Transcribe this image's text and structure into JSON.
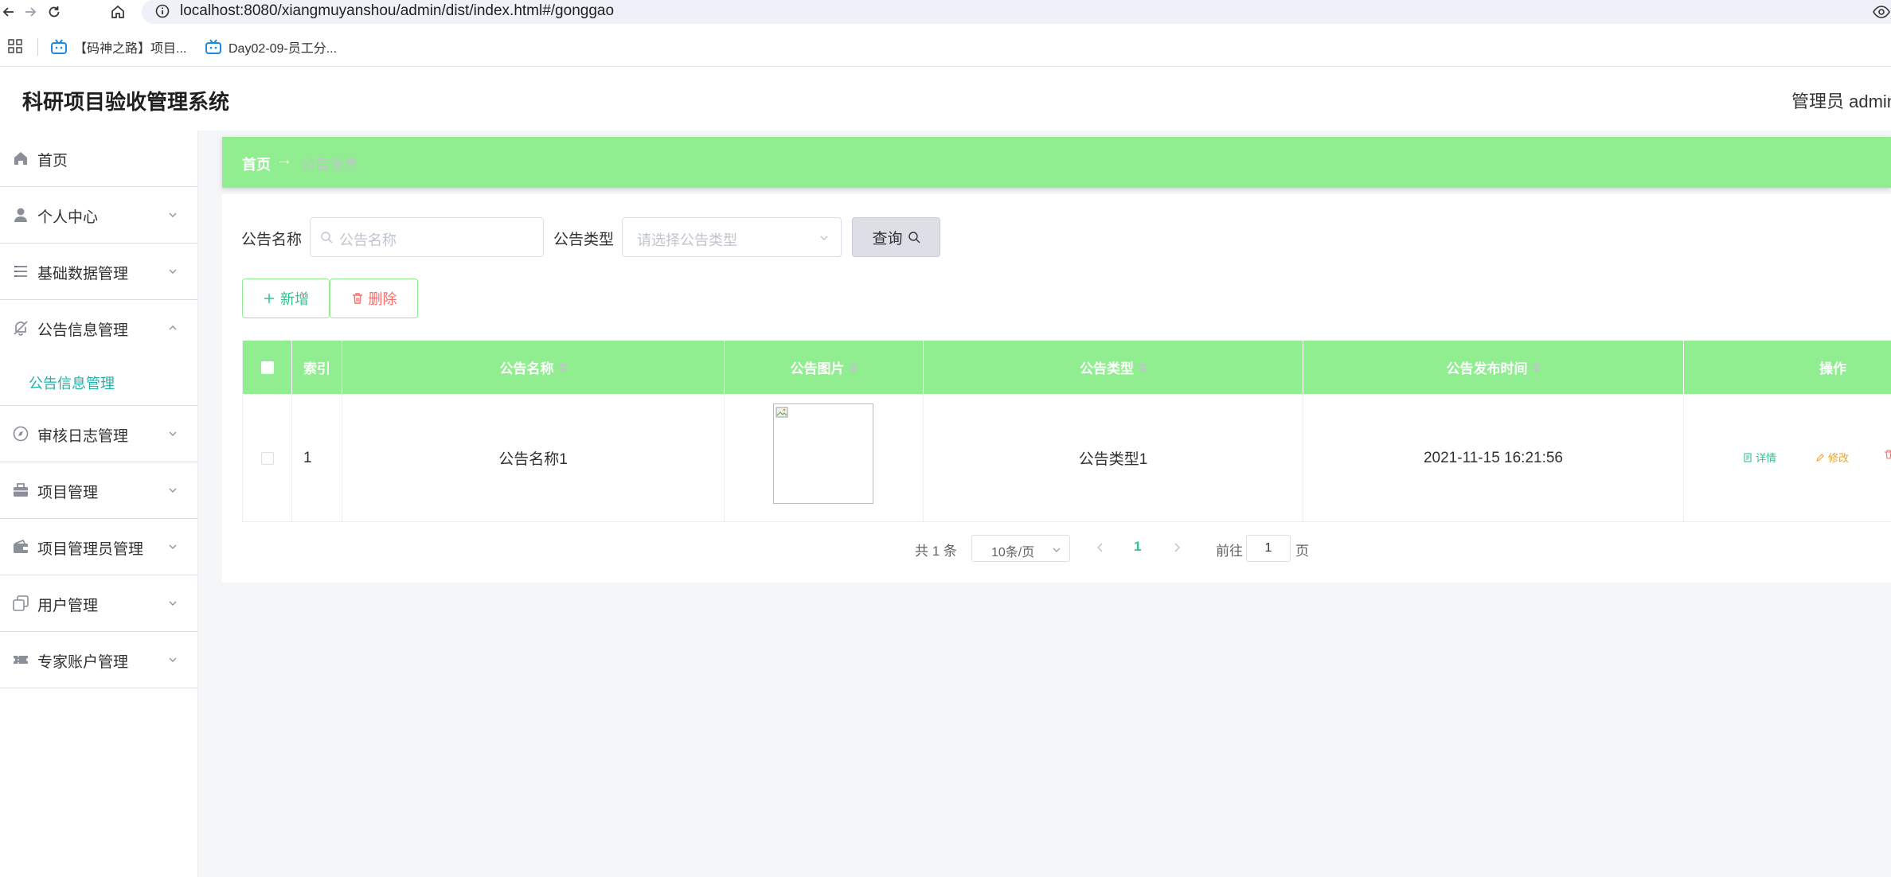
{
  "browser": {
    "url": "localhost:8080/xiangmuyanshou/admin/dist/index.html#/gonggao",
    "bookmarks": [
      {
        "label": "【码神之路】项目..."
      },
      {
        "label": "Day02-09-员工分..."
      }
    ]
  },
  "app": {
    "title": "科研项目验收管理系统",
    "user": "管理员 admin"
  },
  "sidebar": {
    "items": [
      {
        "label": "首页",
        "icon": "home-icon"
      },
      {
        "label": "个人中心",
        "icon": "user-icon"
      },
      {
        "label": "基础数据管理",
        "icon": "list-icon"
      },
      {
        "label": "公告信息管理",
        "icon": "bell-off-icon",
        "expanded": true
      },
      {
        "label": "审核日志管理",
        "icon": "compass-icon"
      },
      {
        "label": "项目管理",
        "icon": "briefcase-icon"
      },
      {
        "label": "项目管理员管理",
        "icon": "wallet-icon"
      },
      {
        "label": "用户管理",
        "icon": "copy-icon"
      },
      {
        "label": "专家账户管理",
        "icon": "ticket-icon"
      }
    ],
    "submenu": {
      "label": "公告信息管理"
    }
  },
  "breadcrumb": {
    "home": "首页",
    "separator": "→",
    "current": "公告信息"
  },
  "search": {
    "name_label": "公告名称",
    "name_placeholder": "公告名称",
    "type_label": "公告类型",
    "type_placeholder": "请选择公告类型",
    "query_button": "查询"
  },
  "actions": {
    "add": "新增",
    "delete": "删除"
  },
  "table": {
    "columns": [
      "索引",
      "公告名称",
      "公告图片",
      "公告类型",
      "公告发布时间",
      "操作"
    ],
    "rows": [
      {
        "index": "1",
        "name": "公告名称1",
        "type": "公告类型1",
        "time": "2021-11-15 16:21:56",
        "ops": [
          "详情",
          "修改"
        ]
      }
    ]
  },
  "pagination": {
    "total": "共 1 条",
    "page_size": "10条/页",
    "current_page": "1",
    "goto_label": "前往",
    "goto_value": "1",
    "page_word": "页"
  },
  "colors": {
    "accent_green": "#90ee90",
    "teal": "#20b2aa",
    "danger": "#f56c6c",
    "warning": "#e6a23c"
  }
}
